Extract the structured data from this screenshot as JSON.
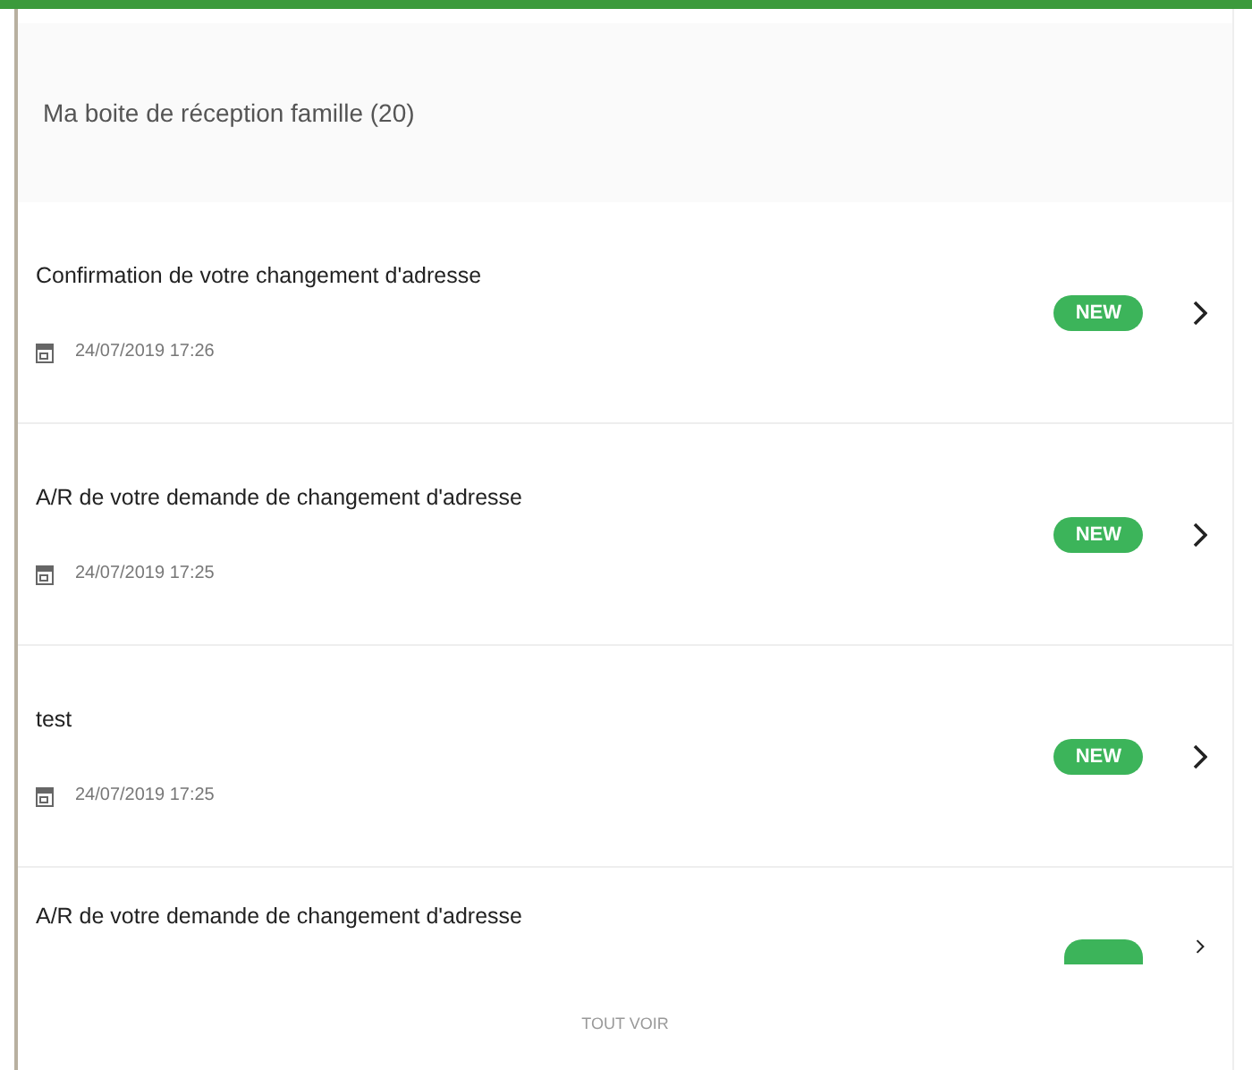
{
  "header": {
    "title": "Ma boite de réception famille (20)"
  },
  "messages": [
    {
      "subject": "Confirmation de votre changement d'adresse",
      "date": "24/07/2019 17:26",
      "new": true,
      "badge": "NEW"
    },
    {
      "subject": "A/R de votre demande de changement d'adresse",
      "date": "24/07/2019 17:25",
      "new": true,
      "badge": "NEW"
    },
    {
      "subject": "test",
      "date": "24/07/2019 17:25",
      "new": true,
      "badge": "NEW"
    },
    {
      "subject": "A/R de votre demande de changement d'adresse",
      "new": true
    }
  ],
  "footer": {
    "link": "TOUT VOIR"
  }
}
